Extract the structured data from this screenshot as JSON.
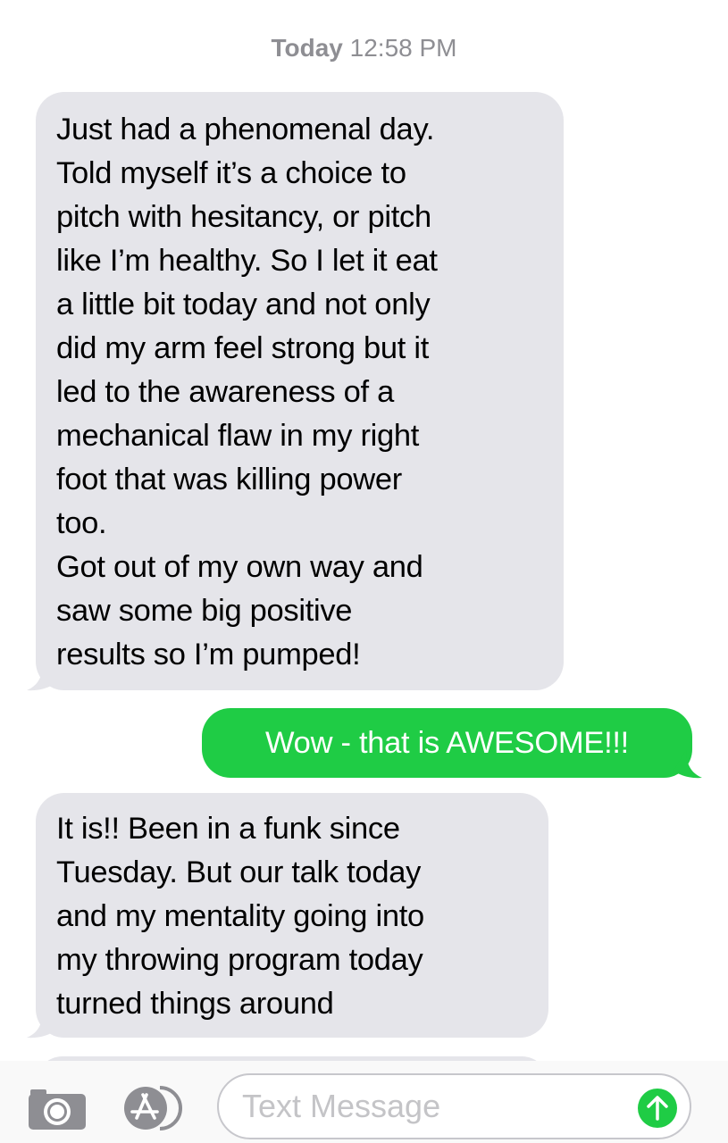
{
  "header": {
    "day": "Today",
    "time": "12:58 PM"
  },
  "messages": [
    {
      "direction": "incoming",
      "lines": [
        "Just had a phenomenal day.",
        "Told myself it’s a choice to",
        "pitch with hesitancy, or pitch",
        "like I’m healthy. So I let it eat",
        "a little bit today and not only",
        "did my arm feel strong but it",
        "led to the awareness of a",
        "mechanical flaw in my right",
        "foot that was killing power",
        "too.",
        "Got out of my own way and",
        "saw some big positive",
        "results so I’m pumped!"
      ]
    },
    {
      "direction": "outgoing",
      "lines": [
        "Wow - that is AWESOME!!!"
      ]
    },
    {
      "direction": "incoming",
      "lines": [
        "It is!! Been in a funk since",
        "Tuesday. But our talk today",
        "and my mentality going into",
        "my throwing program today",
        "turned things around"
      ]
    }
  ],
  "composer": {
    "placeholder": "Text Message",
    "camera_icon": "camera-icon",
    "apps_icon": "app-store-icon",
    "send_icon": "arrow-up-icon"
  },
  "colors": {
    "incoming_bubble": "#e5e5ea",
    "outgoing_bubble": "#1fcc45",
    "timestamp": "#8e8e93",
    "send_button": "#1fcc45",
    "icons": "#8e8e93"
  }
}
